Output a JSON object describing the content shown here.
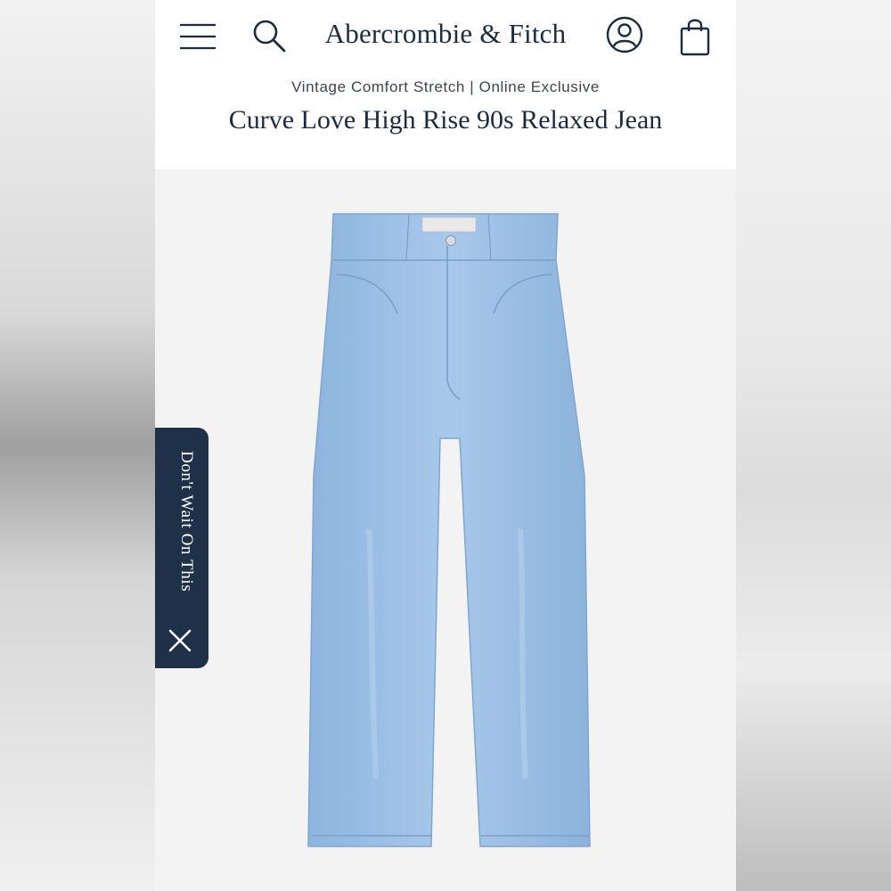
{
  "header": {
    "brand": "Abercrombie & Fitch",
    "subtitle": "Vintage Comfort Stretch | Online Exclusive",
    "title": "Curve Love High Rise 90s Relaxed Jean"
  },
  "promo": {
    "label": "Don't Wait On This"
  },
  "icons": [
    "menu-icon",
    "search-icon",
    "account-icon",
    "shopping-bag-icon",
    "close-icon"
  ],
  "colors": {
    "brand_navy": "#1c2b3e",
    "promo_bg": "#1f3149",
    "denim": "#9cc0e4"
  }
}
